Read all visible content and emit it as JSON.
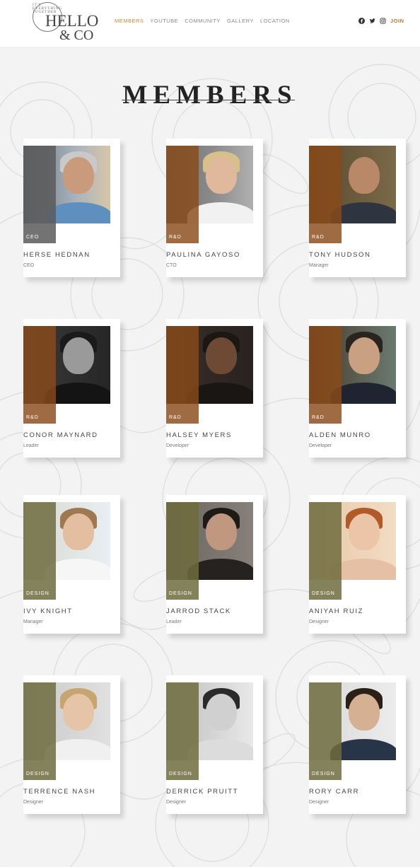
{
  "brand": {
    "arc_text": "IT'S EVERYTHING TOGETHER",
    "name_line1": "HELLO",
    "name_line2": "& CO"
  },
  "nav": {
    "items": [
      "MEMBERS",
      "YOUTUBE",
      "COMMUNITY",
      "GALLERY",
      "LOCATION"
    ],
    "active_index": 0,
    "join_label": "JOIN"
  },
  "social_icons": [
    "facebook-icon",
    "twitter-icon",
    "instagram-icon"
  ],
  "page_title": "MEMBERS",
  "colors": {
    "accent_orange": "#c8873a",
    "badge_gray": "#5a5a5a",
    "badge_rd": "#8a4a1a",
    "badge_design": "#6e6c3e",
    "join": "#b57a38"
  },
  "members": [
    {
      "name": "HERSE HEDNAN",
      "role": "CEO",
      "department": "CEO"
    },
    {
      "name": "PAULINA GAYOSO",
      "role": "CTO",
      "department": "R&D"
    },
    {
      "name": "TONY HUDSON",
      "role": "Manager",
      "department": "R&D"
    },
    {
      "name": "CONOR MAYNARD",
      "role": "Leader",
      "department": "R&D"
    },
    {
      "name": "HALSEY MYERS",
      "role": "Developer",
      "department": "R&D"
    },
    {
      "name": "ALDEN MUNRO",
      "role": "Developer",
      "department": "R&D"
    },
    {
      "name": "IVY KNIGHT",
      "role": "Manager",
      "department": "DESIGN"
    },
    {
      "name": "JARROD STACK",
      "role": "Leader",
      "department": "DESIGN"
    },
    {
      "name": "ANIYAH RUIZ",
      "role": "Designer",
      "department": "DESIGN"
    },
    {
      "name": "TERRENCE NASH",
      "role": "Designer",
      "department": "DESIGN"
    },
    {
      "name": "DERRICK PRUITT",
      "role": "Designer",
      "department": "DESIGN"
    },
    {
      "name": "RORY CARR",
      "role": "Designer",
      "department": "DESIGN"
    }
  ]
}
